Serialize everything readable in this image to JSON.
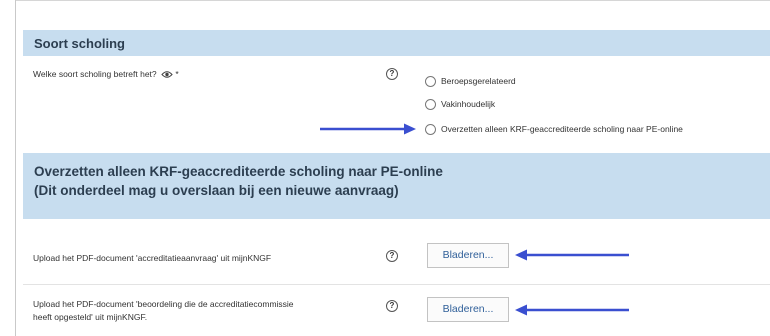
{
  "section1": {
    "title": "Soort scholing",
    "question_label": "Welke soort scholing betreft het?",
    "required_mark": "*",
    "options": [
      "Beroepsgerelateerd",
      "Vakinhoudelijk",
      "Overzetten alleen KRF-geaccrediteerde scholing naar PE-online"
    ]
  },
  "section2": {
    "title_line1": "Overzetten alleen KRF-geaccrediteerde scholing naar PE-online",
    "title_line2": "(Dit onderdeel mag u overslaan bij een nieuwe aanvraag)"
  },
  "upload1": {
    "label": "Upload het PDF-document 'accreditatieaanvraag' uit mijnKNGF",
    "button": "Bladeren..."
  },
  "upload2": {
    "label_line1": "Upload het PDF-document 'beoordeling die de accreditatiecommissie",
    "label_line2": "heeft opgesteld' uit mijnKNGF.",
    "button": "Bladeren..."
  },
  "help_glyph": "?",
  "colors": {
    "section_header_bg": "#c7ddef",
    "arrow": "#3a4fd0",
    "button_text": "#2f5f99"
  },
  "icons": [
    "help-icon",
    "eye-icon",
    "arrow-right-icon",
    "arrow-left-icon"
  ]
}
